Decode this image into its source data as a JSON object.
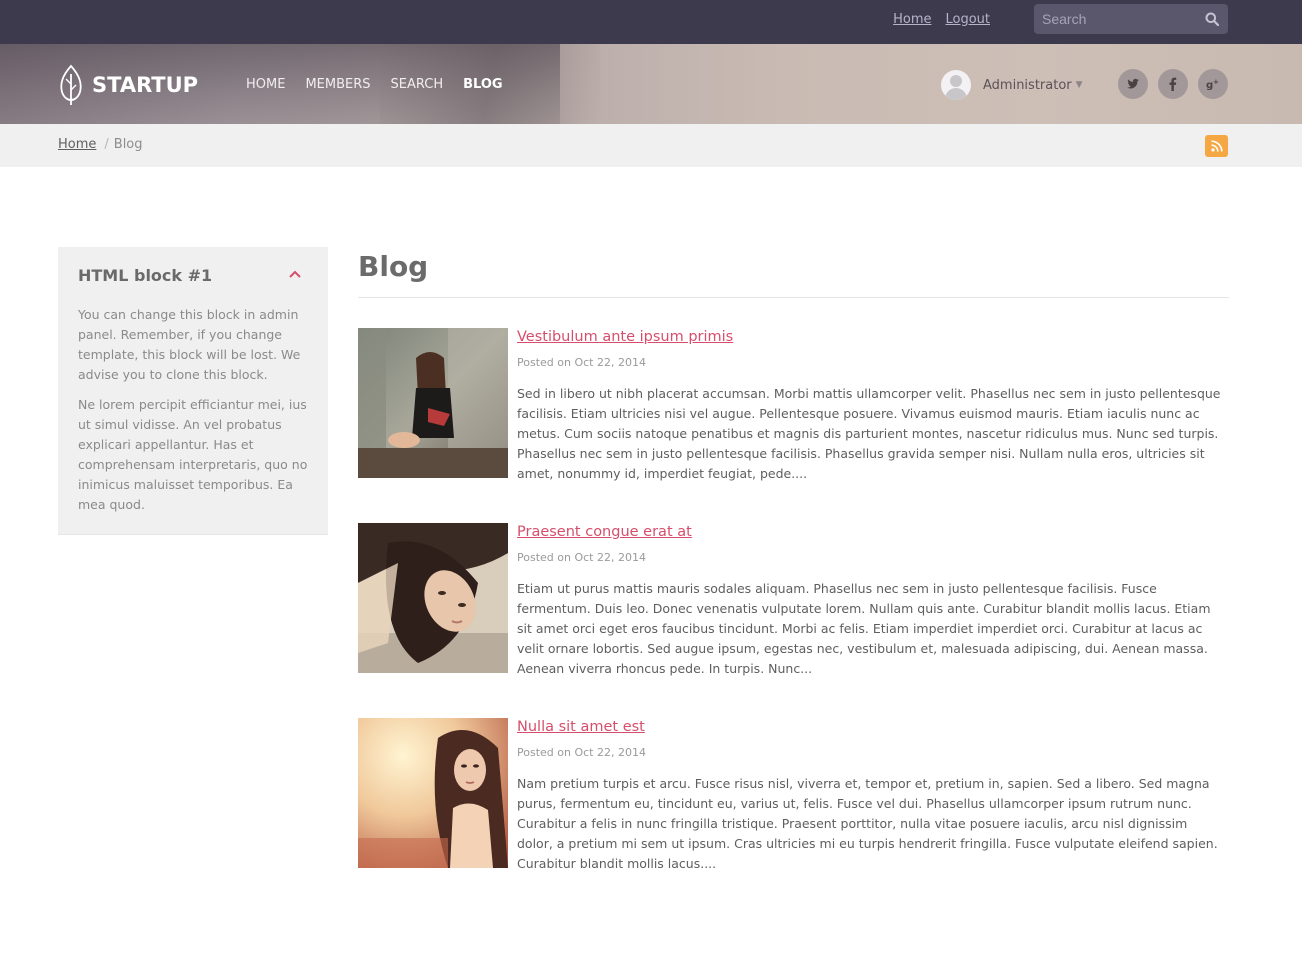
{
  "topbar": {
    "links": [
      "Home",
      "Logout"
    ],
    "search_placeholder": "Search"
  },
  "header": {
    "logo_text": "STARTUP",
    "nav": [
      "HOME",
      "MEMBERS",
      "SEARCH",
      "BLOG"
    ],
    "active_nav": "BLOG",
    "user_name": "Administrator",
    "social": [
      "twitter-icon",
      "facebook-icon",
      "google-plus-icon"
    ]
  },
  "breadcrumb": {
    "home": "Home",
    "current": "Blog"
  },
  "sidebar": {
    "title": "HTML block #1",
    "paragraphs": [
      "You can change this block in admin panel. Remember, if you change template, this block will be lost. We advise you to clone this block.",
      "Ne lorem percipit efficiantur mei, ius ut simul vidisse. An vel probatus explicari appellantur. Has et comprehensam interpretaris, quo no inimicus maluisset temporibus. Ea mea quod."
    ]
  },
  "main": {
    "title": "Blog",
    "posts": [
      {
        "title": "Vestibulum ante ipsum primis",
        "date": "Posted on Oct 22, 2014",
        "excerpt": "Sed in libero ut nibh placerat accumsan. Morbi mattis ullamcorper velit. Phasellus nec sem in justo pellentesque facilisis. Etiam ultricies nisi vel augue. Pellentesque posuere. Vivamus euismod mauris. Etiam iaculis nunc ac metus. Cum sociis natoque penatibus et magnis dis parturient montes, nascetur ridiculus mus. Nunc sed turpis. Phasellus nec sem in justo pellentesque facilisis. Phasellus gravida semper nisi. Nullam nulla eros, ultricies sit amet, nonummy id, imperdiet feugiat, pede...."
      },
      {
        "title": "Praesent congue erat at",
        "date": "Posted on Oct 22, 2014",
        "excerpt": "Etiam ut purus mattis mauris sodales aliquam. Phasellus nec sem in justo pellentesque facilisis. Fusce fermentum. Duis leo. Donec venenatis vulputate lorem. Nullam quis ante. Curabitur blandit mollis lacus. Etiam sit amet orci eget eros faucibus tincidunt. Morbi ac felis. Etiam imperdiet imperdiet orci. Curabitur at lacus ac velit ornare lobortis. Sed augue ipsum, egestas nec, vestibulum et, malesuada adipiscing, dui. Aenean massa. Aenean viverra rhoncus pede. In turpis. Nunc..."
      },
      {
        "title": "Nulla sit amet est",
        "date": "Posted on Oct 22, 2014",
        "excerpt": "Nam pretium turpis et arcu. Fusce risus nisl, viverra et, tempor et, pretium in, sapien. Sed a libero. Sed magna purus, fermentum eu, tincidunt eu, varius ut, felis. Fusce vel dui. Phasellus ullamcorper ipsum rutrum nunc. Curabitur a felis in nunc fringilla tristique. Praesent porttitor, nulla vitae posuere iaculis, arcu nisl dignissim dolor, a pretium mi sem ut ipsum. Cras ultricies mi eu turpis hendrerit fringilla. Fusce vulputate eleifend sapien. Curabitur blandit mollis lacus...."
      }
    ]
  },
  "colors": {
    "topbar": "#3d3a4e",
    "link_accent": "#d64e6b",
    "rss": "#f5a744"
  }
}
